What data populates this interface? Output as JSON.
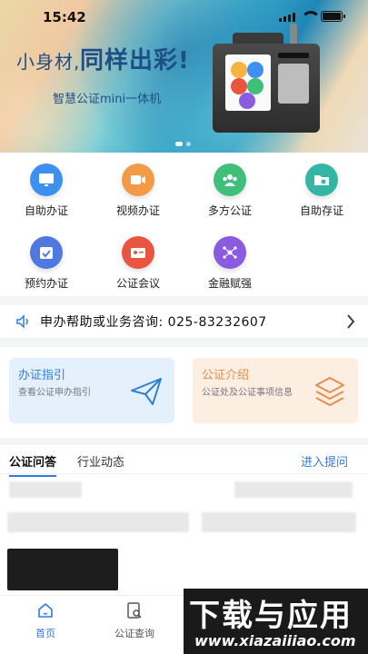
{
  "status_bar": {
    "time": "15:42"
  },
  "banner": {
    "slogan_part1": "小身材,",
    "slogan_part2": "同样出彩!",
    "subtitle": "智慧公证mini一体机",
    "colors": {
      "slogan": "#1d4f86"
    }
  },
  "services": [
    {
      "label": "自助办证",
      "icon": "monitor-icon",
      "color": "#3d8ff0"
    },
    {
      "label": "视频办证",
      "icon": "video-icon",
      "color": "#f39a47"
    },
    {
      "label": "多方公证",
      "icon": "group-icon",
      "color": "#3fbf79"
    },
    {
      "label": "自助存证",
      "icon": "folder-cloud-icon",
      "color": "#33b6a4"
    },
    {
      "label": "预约办证",
      "icon": "calendar-check-icon",
      "color": "#4f79e0"
    },
    {
      "label": "公证会议",
      "icon": "id-card-icon",
      "color": "#e9553f"
    },
    {
      "label": "金融赋强",
      "icon": "network-icon",
      "color": "#8a5be0"
    }
  ],
  "hotline": {
    "text": "申办帮助或业务咨询: 025-83232607",
    "icon": "speaker-icon"
  },
  "cards": {
    "guide": {
      "title": "办证指引",
      "desc": "查看公证申办指引",
      "icon": "paper-plane-icon"
    },
    "intro": {
      "title": "公证介绍",
      "desc": "公证处及公证事项信息",
      "icon": "layers-icon"
    }
  },
  "qa": {
    "tab_active": "公证问答",
    "tab_other": "行业动态",
    "ask_link": "进入提问"
  },
  "bottom_nav": [
    {
      "label": "首页",
      "icon": "home-icon",
      "active": true
    },
    {
      "label": "公证查询",
      "icon": "search-doc-icon",
      "active": false
    }
  ],
  "watermark": {
    "title": "下载与应用",
    "url": "www.xiazaiiiao.com"
  },
  "accent_color": "#2f7be5"
}
